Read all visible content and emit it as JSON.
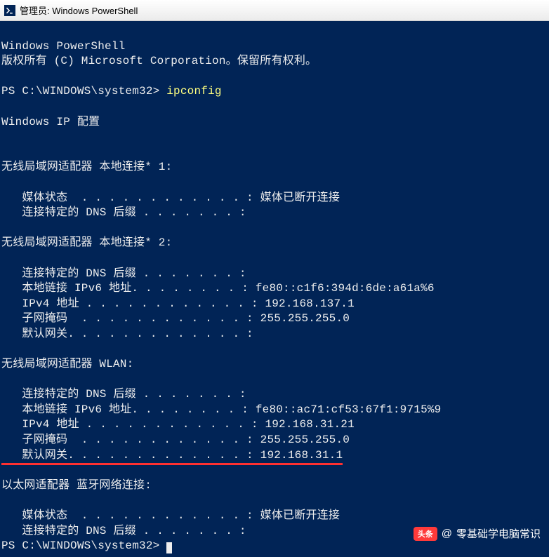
{
  "window": {
    "title": "管理员: Windows PowerShell"
  },
  "header": {
    "line1": "Windows PowerShell",
    "line2": "版权所有 (C) Microsoft Corporation。保留所有权利。"
  },
  "prompt1": {
    "ps": "PS C:\\WINDOWS\\system32> ",
    "cmd": "ipconfig"
  },
  "ipconfig": {
    "title": "Windows IP 配置",
    "adapter1": {
      "name": "无线局域网适配器 本地连接* 1:",
      "media": "   媒体状态  . . . . . . . . . . . . : 媒体已断开连接",
      "dns": "   连接特定的 DNS 后缀 . . . . . . . :"
    },
    "adapter2": {
      "name": "无线局域网适配器 本地连接* 2:",
      "dns": "   连接特定的 DNS 后缀 . . . . . . . :",
      "ipv6": "   本地链接 IPv6 地址. . . . . . . . : fe80::c1f6:394d:6de:a61a%6",
      "ipv4": "   IPv4 地址 . . . . . . . . . . . . : 192.168.137.1",
      "mask": "   子网掩码  . . . . . . . . . . . . : 255.255.255.0",
      "gw": "   默认网关. . . . . . . . . . . . . :"
    },
    "adapter3": {
      "name": "无线局域网适配器 WLAN:",
      "dns": "   连接特定的 DNS 后缀 . . . . . . . :",
      "ipv6": "   本地链接 IPv6 地址. . . . . . . . : fe80::ac71:cf53:67f1:9715%9",
      "ipv4": "   IPv4 地址 . . . . . . . . . . . . : 192.168.31.21",
      "mask": "   子网掩码  . . . . . . . . . . . . : 255.255.255.0",
      "gw": "   默认网关. . . . . . . . . . . . . : 192.168.31.1"
    },
    "adapter4": {
      "name": "以太网适配器 蓝牙网络连接:",
      "media": "   媒体状态  . . . . . . . . . . . . : 媒体已断开连接",
      "dns": "   连接特定的 DNS 后缀 . . . . . . . :"
    }
  },
  "prompt2": {
    "ps": "PS C:\\WINDOWS\\system32> "
  },
  "watermark": {
    "badge": "头条",
    "at": "@",
    "name": "零基础学电脑常识"
  }
}
